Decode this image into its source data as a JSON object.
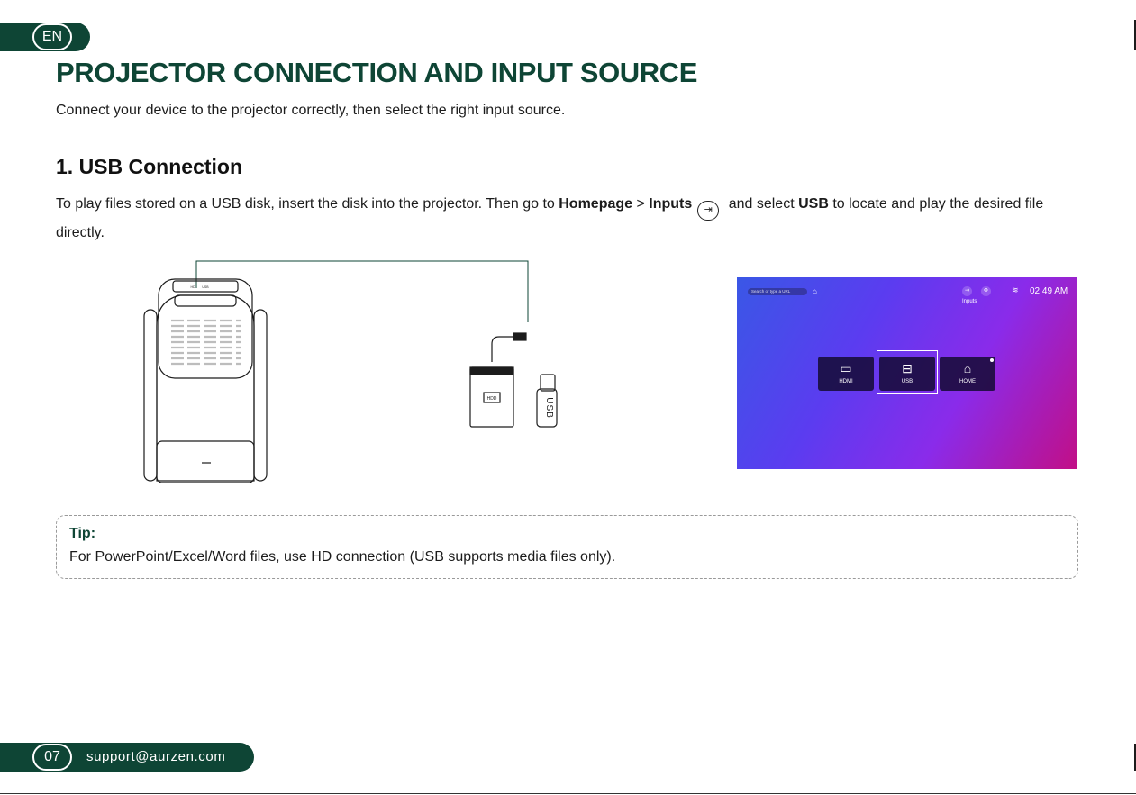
{
  "header": {
    "language": "EN",
    "title": "PROJECTOR CONNECTION AND INPUT SOURCE",
    "intro": "Connect your device to the projector correctly, then select the right input source."
  },
  "section": {
    "title": "1. USB Connection",
    "text_1": "To play files stored on a USB disk, insert the disk into the projector. Then go to ",
    "homepage": "Homepage",
    "arrow": " > ",
    "inputs": "Inputs",
    "inputs_icon": "⇥",
    "text_2": " and select ",
    "usb": "USB",
    "text_3": " to locate and play the desired file directly."
  },
  "illustration": {
    "hdd_label": "HDD",
    "usb_stick_label": "USB",
    "port_labels": [
      "HD",
      "USB"
    ]
  },
  "screen": {
    "search_placeholder": "Search or type a URL",
    "inputs_label": "Inputs",
    "clock": "02:49 AM",
    "tiles": [
      {
        "label": "HDMI",
        "icon": "hdmi-icon"
      },
      {
        "label": "USB",
        "icon": "usb-drive-icon",
        "selected": true
      },
      {
        "label": "HOME",
        "icon": "home-icon"
      }
    ]
  },
  "tip": {
    "label": "Tip:",
    "text": "For PowerPoint/Excel/Word files, use HD connection (USB supports media files only)."
  },
  "footer": {
    "page": "07",
    "email": "support@aurzen.com"
  },
  "colors": {
    "brand_green": "#0e4535",
    "screen_gradient": [
      "#3a57e6",
      "#8a2bea",
      "#c20f86"
    ]
  }
}
